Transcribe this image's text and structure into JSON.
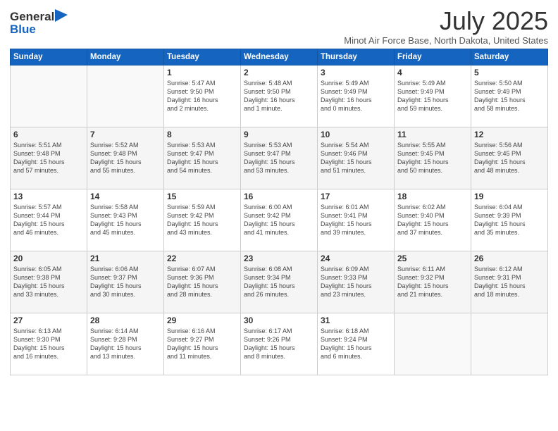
{
  "logo": {
    "general": "General",
    "blue": "Blue"
  },
  "title": "July 2025",
  "location": "Minot Air Force Base, North Dakota, United States",
  "days_of_week": [
    "Sunday",
    "Monday",
    "Tuesday",
    "Wednesday",
    "Thursday",
    "Friday",
    "Saturday"
  ],
  "weeks": [
    [
      {
        "day": "",
        "info": ""
      },
      {
        "day": "",
        "info": ""
      },
      {
        "day": "1",
        "info": "Sunrise: 5:47 AM\nSunset: 9:50 PM\nDaylight: 16 hours\nand 2 minutes."
      },
      {
        "day": "2",
        "info": "Sunrise: 5:48 AM\nSunset: 9:50 PM\nDaylight: 16 hours\nand 1 minute."
      },
      {
        "day": "3",
        "info": "Sunrise: 5:49 AM\nSunset: 9:49 PM\nDaylight: 16 hours\nand 0 minutes."
      },
      {
        "day": "4",
        "info": "Sunrise: 5:49 AM\nSunset: 9:49 PM\nDaylight: 15 hours\nand 59 minutes."
      },
      {
        "day": "5",
        "info": "Sunrise: 5:50 AM\nSunset: 9:49 PM\nDaylight: 15 hours\nand 58 minutes."
      }
    ],
    [
      {
        "day": "6",
        "info": "Sunrise: 5:51 AM\nSunset: 9:48 PM\nDaylight: 15 hours\nand 57 minutes."
      },
      {
        "day": "7",
        "info": "Sunrise: 5:52 AM\nSunset: 9:48 PM\nDaylight: 15 hours\nand 55 minutes."
      },
      {
        "day": "8",
        "info": "Sunrise: 5:53 AM\nSunset: 9:47 PM\nDaylight: 15 hours\nand 54 minutes."
      },
      {
        "day": "9",
        "info": "Sunrise: 5:53 AM\nSunset: 9:47 PM\nDaylight: 15 hours\nand 53 minutes."
      },
      {
        "day": "10",
        "info": "Sunrise: 5:54 AM\nSunset: 9:46 PM\nDaylight: 15 hours\nand 51 minutes."
      },
      {
        "day": "11",
        "info": "Sunrise: 5:55 AM\nSunset: 9:45 PM\nDaylight: 15 hours\nand 50 minutes."
      },
      {
        "day": "12",
        "info": "Sunrise: 5:56 AM\nSunset: 9:45 PM\nDaylight: 15 hours\nand 48 minutes."
      }
    ],
    [
      {
        "day": "13",
        "info": "Sunrise: 5:57 AM\nSunset: 9:44 PM\nDaylight: 15 hours\nand 46 minutes."
      },
      {
        "day": "14",
        "info": "Sunrise: 5:58 AM\nSunset: 9:43 PM\nDaylight: 15 hours\nand 45 minutes."
      },
      {
        "day": "15",
        "info": "Sunrise: 5:59 AM\nSunset: 9:42 PM\nDaylight: 15 hours\nand 43 minutes."
      },
      {
        "day": "16",
        "info": "Sunrise: 6:00 AM\nSunset: 9:42 PM\nDaylight: 15 hours\nand 41 minutes."
      },
      {
        "day": "17",
        "info": "Sunrise: 6:01 AM\nSunset: 9:41 PM\nDaylight: 15 hours\nand 39 minutes."
      },
      {
        "day": "18",
        "info": "Sunrise: 6:02 AM\nSunset: 9:40 PM\nDaylight: 15 hours\nand 37 minutes."
      },
      {
        "day": "19",
        "info": "Sunrise: 6:04 AM\nSunset: 9:39 PM\nDaylight: 15 hours\nand 35 minutes."
      }
    ],
    [
      {
        "day": "20",
        "info": "Sunrise: 6:05 AM\nSunset: 9:38 PM\nDaylight: 15 hours\nand 33 minutes."
      },
      {
        "day": "21",
        "info": "Sunrise: 6:06 AM\nSunset: 9:37 PM\nDaylight: 15 hours\nand 30 minutes."
      },
      {
        "day": "22",
        "info": "Sunrise: 6:07 AM\nSunset: 9:36 PM\nDaylight: 15 hours\nand 28 minutes."
      },
      {
        "day": "23",
        "info": "Sunrise: 6:08 AM\nSunset: 9:34 PM\nDaylight: 15 hours\nand 26 minutes."
      },
      {
        "day": "24",
        "info": "Sunrise: 6:09 AM\nSunset: 9:33 PM\nDaylight: 15 hours\nand 23 minutes."
      },
      {
        "day": "25",
        "info": "Sunrise: 6:11 AM\nSunset: 9:32 PM\nDaylight: 15 hours\nand 21 minutes."
      },
      {
        "day": "26",
        "info": "Sunrise: 6:12 AM\nSunset: 9:31 PM\nDaylight: 15 hours\nand 18 minutes."
      }
    ],
    [
      {
        "day": "27",
        "info": "Sunrise: 6:13 AM\nSunset: 9:30 PM\nDaylight: 15 hours\nand 16 minutes."
      },
      {
        "day": "28",
        "info": "Sunrise: 6:14 AM\nSunset: 9:28 PM\nDaylight: 15 hours\nand 13 minutes."
      },
      {
        "day": "29",
        "info": "Sunrise: 6:16 AM\nSunset: 9:27 PM\nDaylight: 15 hours\nand 11 minutes."
      },
      {
        "day": "30",
        "info": "Sunrise: 6:17 AM\nSunset: 9:26 PM\nDaylight: 15 hours\nand 8 minutes."
      },
      {
        "day": "31",
        "info": "Sunrise: 6:18 AM\nSunset: 9:24 PM\nDaylight: 15 hours\nand 6 minutes."
      },
      {
        "day": "",
        "info": ""
      },
      {
        "day": "",
        "info": ""
      }
    ]
  ]
}
